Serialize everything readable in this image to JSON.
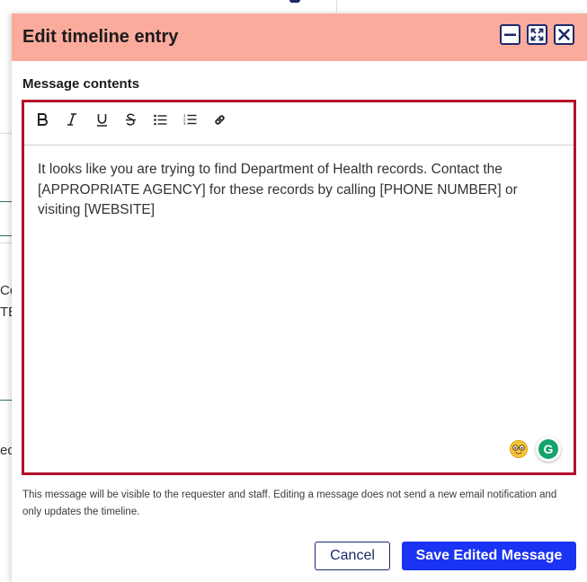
{
  "background": {
    "fragments": [
      "Co",
      "TE]",
      "ed"
    ]
  },
  "modal": {
    "title": "Edit timeline entry",
    "controls": {
      "minimize": "minimize-icon",
      "maximize": "maximize-icon",
      "close": "close-icon"
    },
    "section_label": "Message contents",
    "toolbar": [
      "bold-icon",
      "italic-icon",
      "underline-icon",
      "strikethrough-icon",
      "bullet-list-icon",
      "numbered-list-icon",
      "link-icon"
    ],
    "message_text": "It looks like you are trying to find Department of Health records. Contact the [APPROPRIATE AGENCY] for these records by calling [PHONE NUMBER] or visiting [WEBSITE]",
    "grammarly_letter": "G",
    "notice": "This message will be visible to the requester and staff. Editing a message does not send a new email notification and only updates the timeline.",
    "cancel_label": "Cancel",
    "save_label": "Save Edited Message"
  },
  "colors": {
    "header_bg": "#fbab9c",
    "editor_border": "#b5102a",
    "primary_button": "#1b33f2",
    "navy": "#1d2a6b",
    "grammarly": "#15a36a"
  }
}
